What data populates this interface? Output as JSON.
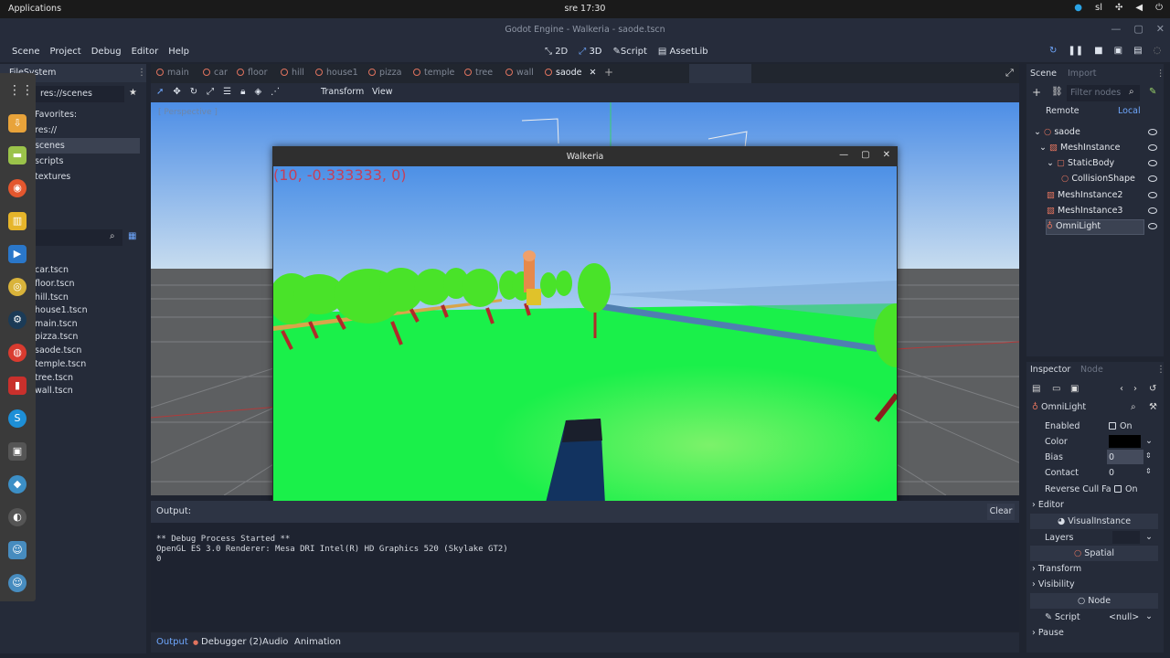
{
  "system_bar": {
    "applications": "Applications",
    "clock": "sre 17:30",
    "keyboard": "sl"
  },
  "window": {
    "title": "Godot Engine - Walkeria - saode.tscn"
  },
  "menu": {
    "items": [
      "Scene",
      "Project",
      "Debug",
      "Editor",
      "Help"
    ]
  },
  "modes": {
    "items": [
      "2D",
      "3D",
      "Script",
      "AssetLib"
    ]
  },
  "filesystem": {
    "header": "FileSystem",
    "path": "res://scenes",
    "tree": [
      "Favorites:",
      "res://",
      "scenes",
      "scripts",
      "textures"
    ],
    "files": [
      "car.tscn",
      "floor.tscn",
      "hill.tscn",
      "house1.tscn",
      "main.tscn",
      "pizza.tscn",
      "saode.tscn",
      "temple.tscn",
      "tree.tscn",
      "wall.tscn"
    ]
  },
  "tabs": {
    "items": [
      "main",
      "car",
      "floor",
      "hill",
      "house1",
      "pizza",
      "temple",
      "tree",
      "wall",
      "saode"
    ]
  },
  "viewport_toolbar": {
    "transform": "Transform",
    "view": "View",
    "perspective": "[ Perspective ]"
  },
  "game_window": {
    "title": "Walkeria",
    "coordinates": "(10, -0.333333, 0)"
  },
  "output": {
    "label": "Output:",
    "clear": "Clear",
    "lines": [
      "** Debug Process Started **",
      "OpenGL ES 3.0 Renderer: Mesa DRI Intel(R) HD Graphics 520 (Skylake GT2)",
      "0"
    ]
  },
  "bottom_tabs": {
    "output": "Output",
    "debugger": "Debugger (2)",
    "audio": "Audio",
    "animation": "Animation"
  },
  "scene_dock": {
    "tab_scene": "Scene",
    "tab_import": "Import",
    "filter_placeholder": "Filter nodes",
    "remote": "Remote",
    "local": "Local",
    "nodes": [
      "saode",
      "MeshInstance",
      "StaticBody",
      "CollisionShape",
      "MeshInstance2",
      "MeshInstance3",
      "OmniLight"
    ]
  },
  "inspector": {
    "tab_inspector": "Inspector",
    "tab_node": "Node",
    "node_name": "OmniLight",
    "enabled_label": "Enabled",
    "enabled_value": "On",
    "color_label": "Color",
    "bias_label": "Bias",
    "bias_value": "0",
    "contact_label": "Contact",
    "contact_value": "0",
    "reverse_cull_label": "Reverse Cull Fa",
    "reverse_cull_value": "On",
    "editor_label": "Editor",
    "visual_instance": "VisualInstance",
    "layers_label": "Layers",
    "spatial": "Spatial",
    "transform_label": "Transform",
    "visibility_label": "Visibility",
    "node_section": "Node",
    "script_label": "Script",
    "script_value": "<null>",
    "pause_label": "Pause"
  },
  "colors": {
    "accent": "#6fa8ff",
    "scene_icon": "#e0735e",
    "coord_text": "#c4405a"
  }
}
